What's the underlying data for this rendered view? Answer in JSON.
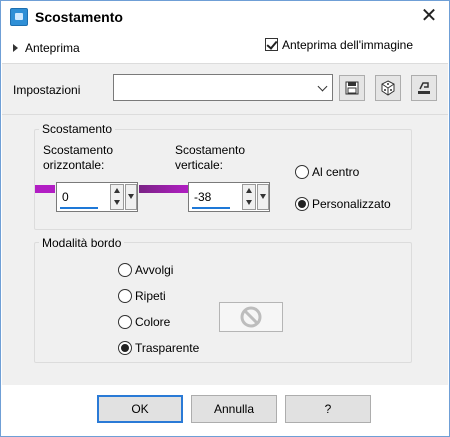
{
  "window": {
    "title": "Scostamento"
  },
  "preview": {
    "toggle_label": "Anteprima",
    "image_preview_label": "Anteprima dell'immagine",
    "image_preview_checked": true
  },
  "settings": {
    "label": "Impostazioni",
    "value": ""
  },
  "offset_group": {
    "title": "Scostamento",
    "horizontal_label_1": "Scostamento",
    "horizontal_label_2": "orizzontale:",
    "horizontal_value": "0",
    "vertical_label_1": "Scostamento",
    "vertical_label_2": "verticale:",
    "vertical_value": "-38",
    "center_label": "Al centro",
    "custom_label": "Personalizzato",
    "selected": "custom"
  },
  "edge_group": {
    "title": "Modalità bordo",
    "options": [
      "Avvolgi",
      "Ripeti",
      "Colore",
      "Trasparente"
    ],
    "selected": "Trasparente"
  },
  "buttons": {
    "ok": "OK",
    "cancel": "Annulla",
    "help": "?"
  },
  "colors": {
    "accent": "#1e78d7",
    "slider_fill": "#b21ec4"
  }
}
